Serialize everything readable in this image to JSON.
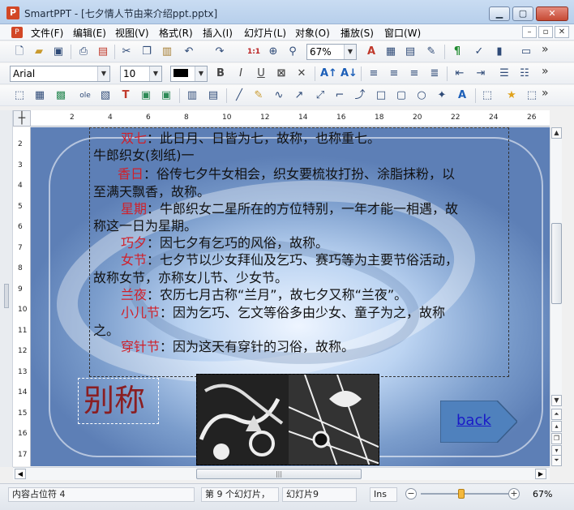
{
  "window": {
    "app_icon_letter": "P",
    "title": "SmartPPT - [七夕情人节由来介绍ppt.pptx]",
    "minimize": "▁",
    "maximize": "▢",
    "close": "✕"
  },
  "menu": {
    "doc_icon_letter": "P",
    "items": [
      "文件(F)",
      "编辑(E)",
      "视图(V)",
      "格式(R)",
      "插入(I)",
      "幻灯片(L)",
      "对象(O)",
      "播放(S)",
      "窗口(W)"
    ],
    "mdi": [
      "–",
      "▫",
      "✕"
    ]
  },
  "toolbar1": {
    "zoom_value": "67%",
    "more": "»"
  },
  "toolbar2": {
    "font_name": "Arial",
    "font_size": "10",
    "font_color": "#000000",
    "bold": "B",
    "italic": "I",
    "underline": "U",
    "more": "»"
  },
  "toolbar3": {
    "more": "»"
  },
  "ruler": {
    "corner": "┼",
    "h_numbers": [
      "2",
      "4",
      "6",
      "8",
      "10",
      "12",
      "14",
      "16",
      "18",
      "20",
      "22",
      "24",
      "26"
    ],
    "v_numbers": [
      "2",
      "3",
      "4",
      "5",
      "6",
      "7",
      "8",
      "9",
      "10",
      "11",
      "12",
      "13",
      "14",
      "15",
      "16",
      "17"
    ]
  },
  "slide": {
    "lines": [
      {
        "indent": true,
        "term": "双七",
        "text": "：此日月、日皆为七，故称，也称重七。"
      },
      {
        "indent": false,
        "term": "",
        "text": "牛郎织女(刻纸)一"
      },
      {
        "indent": true,
        "term": "香日",
        "text": "：俗传七夕牛女相会，织女要梳妆打扮、涂脂抹粉，以"
      },
      {
        "indent": false,
        "term": "",
        "text": "至满天飘香，故称。"
      },
      {
        "indent": true,
        "term": "星期",
        "text": "：牛郎织女二星所在的方位特别，一年才能一相遇，故"
      },
      {
        "indent": false,
        "term": "",
        "text": "称这一日为星期。"
      },
      {
        "indent": true,
        "term": "巧夕",
        "text": "：因七夕有乞巧的风俗，故称。"
      },
      {
        "indent": true,
        "term": "女节",
        "text": "：七夕节以少女拜仙及乞巧、赛巧等为主要节俗活动，"
      },
      {
        "indent": false,
        "term": "",
        "text": "故称女节，亦称女儿节、少女节。"
      },
      {
        "indent": true,
        "term": "兰夜",
        "text": "：农历七月古称“兰月”，故七夕又称“兰夜”。"
      },
      {
        "indent": true,
        "term": "小儿节",
        "text": "：因为乞巧、乞文等俗多由少女、童子为之，故称"
      },
      {
        "indent": false,
        "term": "",
        "text": "之。"
      },
      {
        "indent": true,
        "term": "穿针节",
        "text": "：因为这天有穿针的习俗，故称。"
      }
    ],
    "alias_title": "别称",
    "back_label": "back"
  },
  "status": {
    "placeholder": "内容占位符 4",
    "slide_index": "第 9 个幻灯片，",
    "slide_name": "幻灯片9",
    "insert_mode": "Ins",
    "zoom_minus": "−",
    "zoom_plus": "+",
    "zoom": "67%",
    "zoom_level_fraction": 0.45
  }
}
